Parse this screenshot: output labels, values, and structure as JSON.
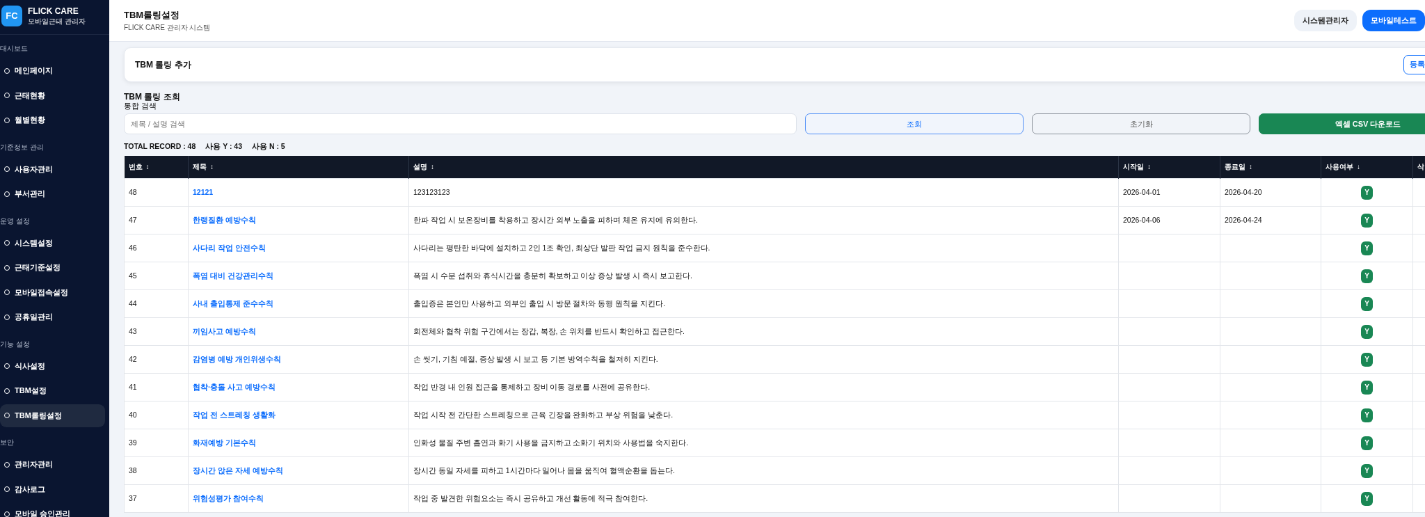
{
  "sidebar": {
    "brand": {
      "logo": "FC",
      "title": "FLICK CARE",
      "subtitle": "모바일근태 관리자"
    },
    "sections": [
      {
        "label": "대시보드",
        "items": [
          {
            "label": "메인페이지",
            "selected": false
          },
          {
            "label": "근태현황",
            "selected": false
          },
          {
            "label": "월별현황",
            "selected": false
          }
        ]
      },
      {
        "label": "기준정보 관리",
        "items": [
          {
            "label": "사용자관리",
            "selected": false
          },
          {
            "label": "부서관리",
            "selected": false
          }
        ]
      },
      {
        "label": "운영 설정",
        "items": [
          {
            "label": "시스템설정",
            "selected": false
          },
          {
            "label": "근태기준설정",
            "selected": false
          },
          {
            "label": "모바일접속설정",
            "selected": false
          },
          {
            "label": "공휴일관리",
            "selected": false
          }
        ]
      },
      {
        "label": "기능 설정",
        "items": [
          {
            "label": "식사설정",
            "selected": false
          },
          {
            "label": "TBM설정",
            "selected": false
          },
          {
            "label": "TBM롤링설정",
            "selected": true
          }
        ]
      },
      {
        "label": "보안",
        "items": [
          {
            "label": "관리자관리",
            "selected": false
          },
          {
            "label": "감사로그",
            "selected": false
          },
          {
            "label": "모바일 승인관리",
            "selected": false
          }
        ]
      }
    ]
  },
  "header": {
    "title": "TBM롤링설정",
    "subtitle": "FLICK CARE 관리자 시스템",
    "buttons": [
      {
        "label": "시스템관리자",
        "kind": "secondary"
      },
      {
        "label": "모바일테스트",
        "kind": "primary"
      }
    ]
  },
  "add_panel": {
    "title": "TBM 롤링 추가",
    "button": "등록"
  },
  "search": {
    "title": "TBM 롤링 조회",
    "label": "통합 검색",
    "placeholder": "제목 / 설명 검색",
    "buttons": [
      {
        "label": "조회",
        "kind": "search"
      },
      {
        "label": "초기화",
        "kind": "reset"
      },
      {
        "label": "엑셀 CSV 다운로드",
        "kind": "download"
      }
    ]
  },
  "summary": [
    "TOTAL RECORD : 48",
    "사용 Y : 43",
    "사용 N : 5"
  ],
  "table": {
    "columns": [
      {
        "label": "번호",
        "sort": "↕"
      },
      {
        "label": "제목",
        "sort": "↕"
      },
      {
        "label": "설명",
        "sort": "↕"
      },
      {
        "label": "시작일",
        "sort": "↕"
      },
      {
        "label": "종료일",
        "sort": "↕"
      },
      {
        "label": "사용여부",
        "sort": "↓"
      },
      {
        "label": "삭"
      }
    ],
    "rows": [
      {
        "no": "48",
        "title": "12121",
        "description": "123123123",
        "start": "2026-04-01",
        "end": "2026-04-20",
        "in_use": "Y"
      },
      {
        "no": "47",
        "title": "한랭질환 예방수칙",
        "description": "한파 작업 시 보온장비를 착용하고 장시간 외부 노출을 피하며 체온 유지에 유의한다.",
        "start": "2026-04-06",
        "end": "2026-04-24",
        "in_use": "Y"
      },
      {
        "no": "46",
        "title": "사다리 작업 안전수칙",
        "description": "사다리는 평탄한 바닥에 설치하고 2인 1조 확인, 최상단 발판 작업 금지 원칙을 준수한다.",
        "in_use": "Y"
      },
      {
        "no": "45",
        "title": "폭염 대비 건강관리수칙",
        "description": "폭염 시 수분 섭취와 휴식시간을 충분히 확보하고 이상 증상 발생 시 즉시 보고한다.",
        "in_use": "Y"
      },
      {
        "no": "44",
        "title": "사내 출입통제 준수수칙",
        "description": "출입증은 본인만 사용하고 외부인 출입 시 방문 절차와 동행 원칙을 지킨다.",
        "in_use": "Y"
      },
      {
        "no": "43",
        "title": "끼임사고 예방수칙",
        "description": "회전체와 협착 위험 구간에서는 장갑, 복장, 손 위치를 반드시 확인하고 접근한다.",
        "in_use": "Y"
      },
      {
        "no": "42",
        "title": "감염병 예방 개인위생수칙",
        "description": "손 씻기, 기침 예절, 증상 발생 시 보고 등 기본 방역수칙을 철저히 지킨다.",
        "in_use": "Y"
      },
      {
        "no": "41",
        "title": "협착·충돌 사고 예방수칙",
        "description": "작업 반경 내 인원 접근을 통제하고 장비 이동 경로를 사전에 공유한다.",
        "in_use": "Y"
      },
      {
        "no": "40",
        "title": "작업 전 스트레칭 생활화",
        "description": "작업 시작 전 간단한 스트레칭으로 근육 긴장을 완화하고 부상 위험을 낮춘다.",
        "in_use": "Y"
      },
      {
        "no": "39",
        "title": "화재예방 기본수칙",
        "description": "인화성 물질 주변 흡연과 화기 사용을 금지하고 소화기 위치와 사용법을 숙지한다.",
        "in_use": "Y"
      },
      {
        "no": "38",
        "title": "장시간 앉은 자세 예방수칙",
        "description": "장시간 동일 자세를 피하고 1시간마다 일어나 몸을 움직여 혈액순환을 돕는다.",
        "in_use": "Y"
      },
      {
        "no": "37",
        "title": "위험성평가 참여수칙",
        "description": "작업 중 발견한 위험요소는 즉시 공유하고 개선 활동에 적극 참여한다.",
        "in_use": "Y"
      }
    ]
  }
}
